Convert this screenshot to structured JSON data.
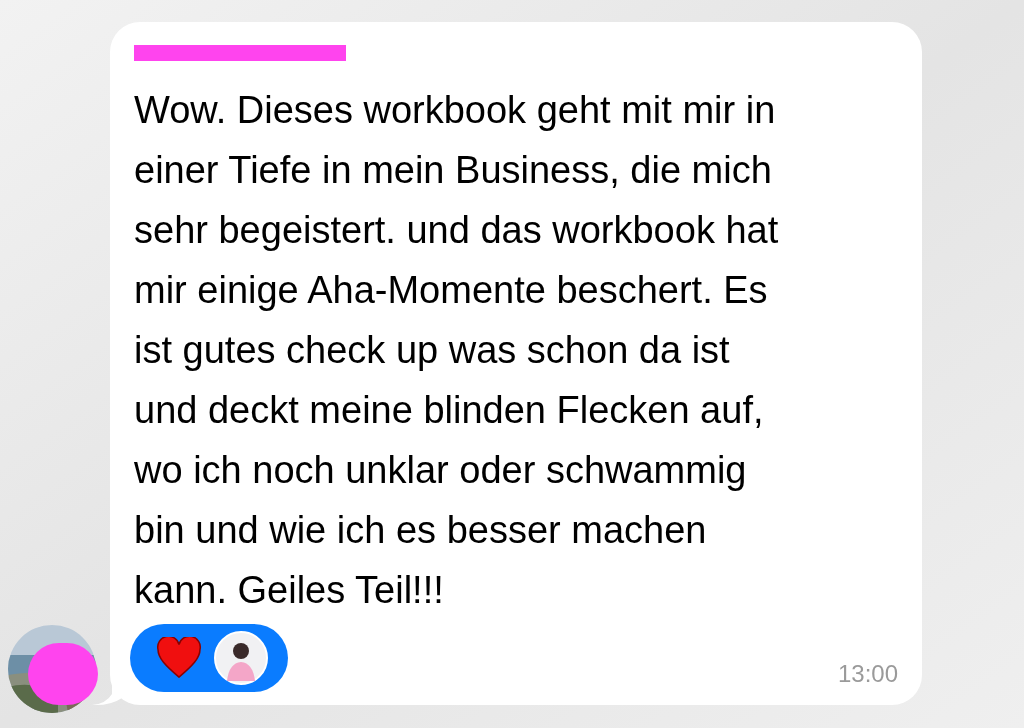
{
  "message": {
    "lines": [
      "Wow. Dieses workbook geht mit mir in",
      "einer Tiefe in mein Business, die mich",
      "sehr begeistert. und das workbook hat",
      "mir einige Aha-Momente beschert. Es",
      "ist gutes check up was schon da ist",
      "und deckt meine blinden Flecken auf,",
      "wo ich noch unklar oder schwammig",
      "bin und wie ich es besser machen",
      "kann. Geiles Teil!!!"
    ],
    "time": "13:00"
  }
}
